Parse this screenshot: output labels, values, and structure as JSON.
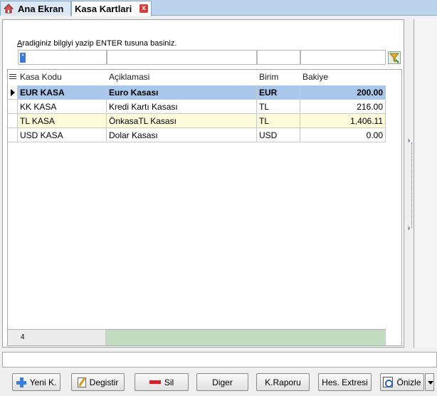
{
  "tabs": [
    {
      "label": "Ana Ekran"
    },
    {
      "label": "Kasa Kartlari",
      "close": "x"
    }
  ],
  "search": {
    "hint_prefix": "A",
    "hint_rest": "radiginiz bilgiyi yazip ENTER tusuna basiniz.",
    "caret": "*"
  },
  "grid": {
    "columns": [
      "Kasa Kodu",
      "Açiklamasi",
      "Birim",
      "Bakiye"
    ],
    "rows": [
      {
        "kod": "EUR KASA",
        "aciklama": "Euro Kasası",
        "birim": "EUR",
        "bakiye": "200.00"
      },
      {
        "kod": "KK KASA",
        "aciklama": "Kredi Kartı Kasası",
        "birim": "TL",
        "bakiye": "216.00"
      },
      {
        "kod": "TL KASA",
        "aciklama": "ÖnkasaTL Kasası",
        "birim": "TL",
        "bakiye": "1,406.11"
      },
      {
        "kod": "USD KASA",
        "aciklama": "Dolar Kasası",
        "birim": "USD",
        "bakiye": "0.00"
      }
    ],
    "record_count": "4"
  },
  "side": {
    "up": "›",
    "down": "›"
  },
  "buttons": {
    "yeni": "Yeni K.",
    "degistir": "Degistir",
    "sil": "Sil",
    "diger": "Diger",
    "kraporu": "K.Raporu",
    "hesextresi": "Hes. Extresi",
    "onizle": "Önizle"
  },
  "colors": {
    "selected_row": "#a9c7ea",
    "alt_row": "#fdfbdc",
    "footer_green": "#c2dcc2",
    "tabbar": "#bcd3ee"
  }
}
